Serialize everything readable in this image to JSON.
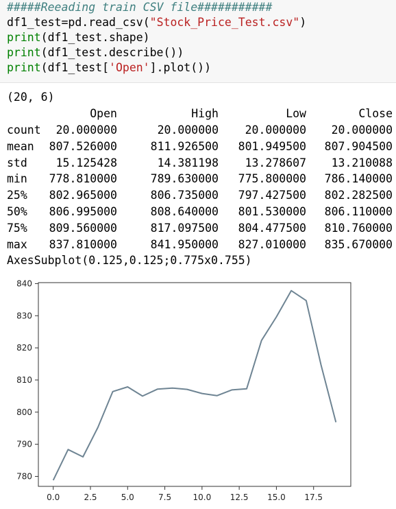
{
  "code_cell": {
    "lines": [
      {
        "comment": "#####Reeading train CSV file###########"
      },
      {
        "var": "df1_test",
        "op": "=",
        "call": "pd.read_csv(",
        "str": "\"Stock_Price_Test.csv\"",
        "close": ")"
      },
      {
        "fn": "print",
        "rest": "(df1_test.shape)"
      },
      {
        "fn": "print",
        "rest": "(df1_test.describe())"
      },
      {
        "fn": "print",
        "open": "(df1_test[",
        "str": "'Open'",
        "rest": "].plot())"
      }
    ]
  },
  "output": {
    "shape": "(20, 6)",
    "columns": [
      "Open",
      "High",
      "Low",
      "Close"
    ],
    "rows": [
      {
        "label": "count",
        "values": [
          "20.000000",
          "20.000000",
          "20.000000",
          "20.000000"
        ]
      },
      {
        "label": "mean",
        "values": [
          "807.526000",
          "811.926500",
          "801.949500",
          "807.904500"
        ]
      },
      {
        "label": "std",
        "values": [
          "15.125428",
          "14.381198",
          "13.278607",
          "13.210088"
        ]
      },
      {
        "label": "min",
        "values": [
          "778.810000",
          "789.630000",
          "775.800000",
          "786.140000"
        ]
      },
      {
        "label": "25%",
        "values": [
          "802.965000",
          "806.735000",
          "797.427500",
          "802.282500"
        ]
      },
      {
        "label": "50%",
        "values": [
          "806.995000",
          "808.640000",
          "801.530000",
          "806.110000"
        ]
      },
      {
        "label": "75%",
        "values": [
          "809.560000",
          "817.097500",
          "804.477500",
          "810.760000"
        ]
      },
      {
        "label": "max",
        "values": [
          "837.810000",
          "841.950000",
          "827.010000",
          "835.670000"
        ]
      }
    ],
    "axes_repr": "AxesSubplot(0.125,0.125;0.775x0.755)"
  },
  "chart_data": {
    "type": "line",
    "x": [
      0,
      1,
      2,
      3,
      4,
      5,
      6,
      7,
      8,
      9,
      10,
      11,
      12,
      13,
      14,
      15,
      16,
      17,
      18,
      19
    ],
    "series": [
      {
        "values": [
          778.81,
          788.36,
          786.08,
          795.26,
          806.4,
          807.86,
          805.0,
          807.14,
          807.48,
          807.08,
          805.81,
          805.12,
          806.91,
          807.25,
          822.3,
          829.62,
          837.81,
          834.71,
          814.66,
          796.86
        ]
      }
    ],
    "xlim": [
      -1,
      20
    ],
    "ylim": [
      776.9,
      840.3
    ],
    "xticks": [
      "0.0",
      "2.5",
      "5.0",
      "7.5",
      "10.0",
      "12.5",
      "15.0",
      "17.5"
    ],
    "xtick_values": [
      0,
      2.5,
      5,
      7.5,
      10,
      12.5,
      15,
      17.5
    ],
    "yticks": [
      "780",
      "790",
      "800",
      "810",
      "820",
      "830",
      "840"
    ],
    "ytick_values": [
      780,
      790,
      800,
      810,
      820,
      830,
      840
    ],
    "grid": false,
    "line_color": "#6e8493"
  }
}
